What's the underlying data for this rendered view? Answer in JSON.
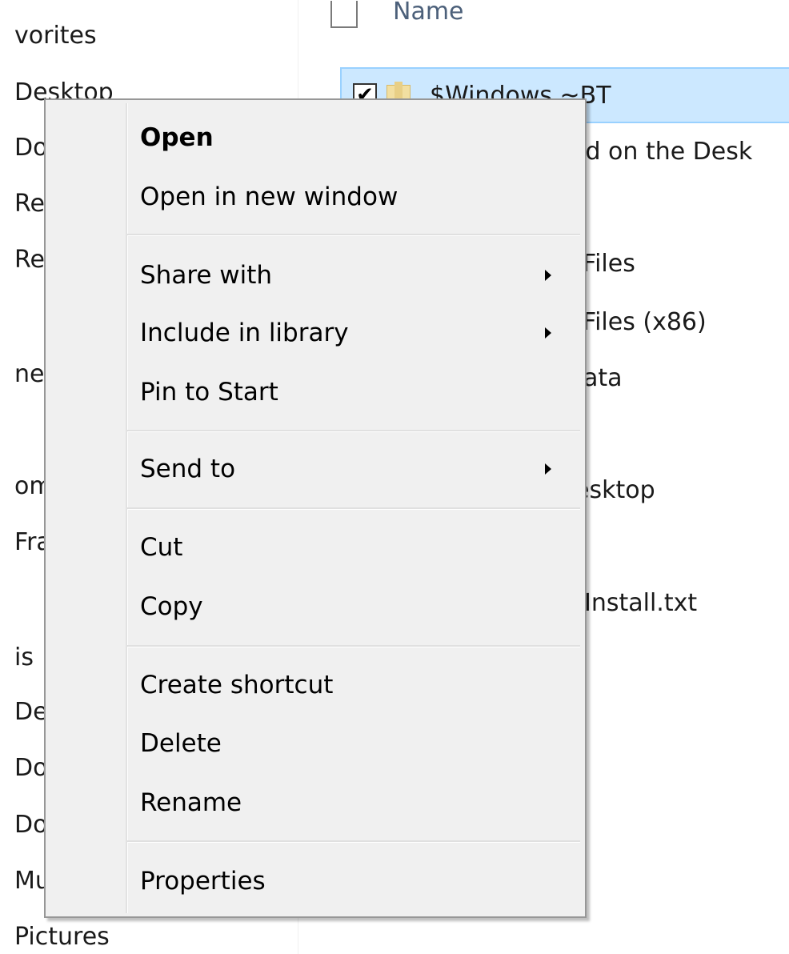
{
  "nav_pane": {
    "items": [
      "vorites",
      "Desktop",
      "Do",
      "Re",
      "Re",
      "ne",
      "om",
      "Fra",
      "is",
      "De",
      "Do",
      "Do",
      "Mu",
      "Pictures"
    ]
  },
  "file_list": {
    "column_header": "Name",
    "selected_row": {
      "checked_mark": "✔",
      "name": "$Windows.~BT"
    },
    "partial_rows": [
      "ed on the Desk",
      "Files",
      "Files (x86)",
      "ata",
      "esktop",
      "Install.txt"
    ]
  },
  "context_menu": {
    "groups": [
      [
        {
          "label": "Open",
          "bold": true,
          "submenu": false
        },
        {
          "label": "Open in new window",
          "bold": false,
          "submenu": false
        }
      ],
      [
        {
          "label": "Share with",
          "bold": false,
          "submenu": true
        },
        {
          "label": "Include in library",
          "bold": false,
          "submenu": true
        },
        {
          "label": "Pin to Start",
          "bold": false,
          "submenu": false
        }
      ],
      [
        {
          "label": "Send to",
          "bold": false,
          "submenu": true
        }
      ],
      [
        {
          "label": "Cut",
          "bold": false,
          "submenu": false
        },
        {
          "label": "Copy",
          "bold": false,
          "submenu": false
        }
      ],
      [
        {
          "label": "Create shortcut",
          "bold": false,
          "submenu": false
        },
        {
          "label": "Delete",
          "bold": false,
          "submenu": false
        },
        {
          "label": "Rename",
          "bold": false,
          "submenu": false
        }
      ],
      [
        {
          "label": "Properties",
          "bold": false,
          "submenu": false
        }
      ]
    ]
  }
}
